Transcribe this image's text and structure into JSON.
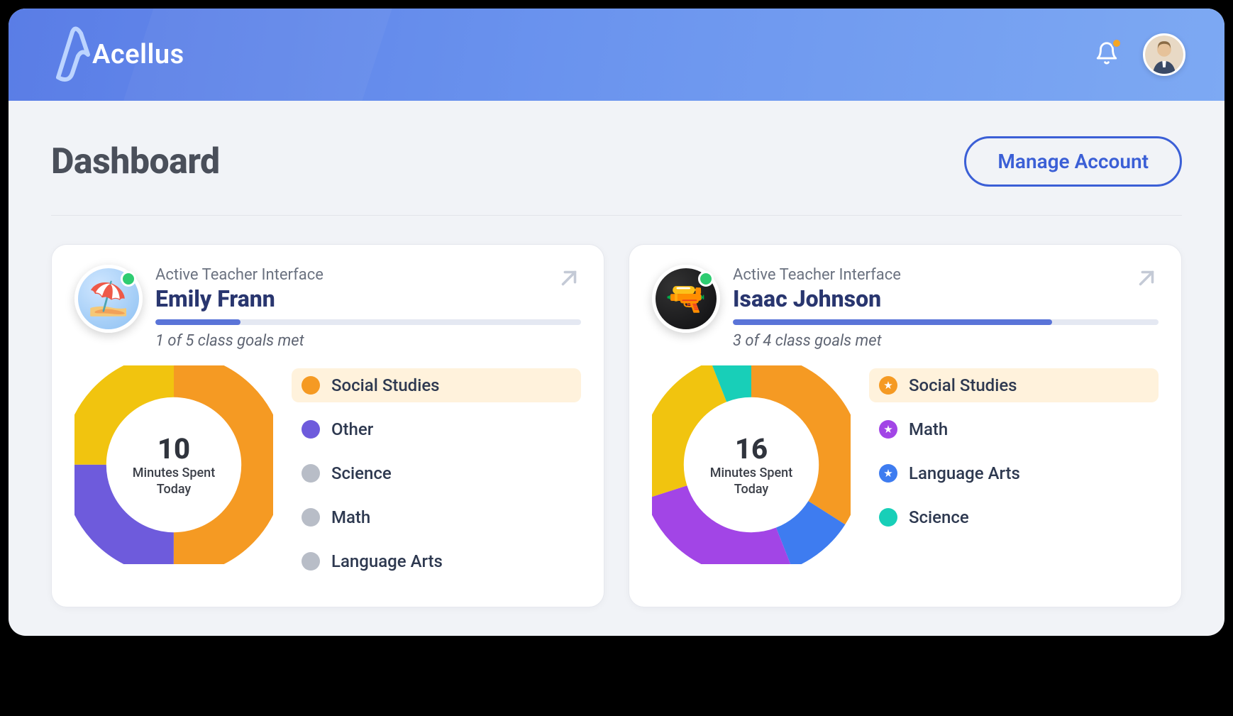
{
  "brand": "Acellus",
  "header": {
    "manage_button": "Manage Account"
  },
  "page_title": "Dashboard",
  "donut_labels": {
    "line1": "Minutes Spent",
    "line2": "Today"
  },
  "chart_data": [
    {
      "type": "pie",
      "title": "Emily Frann — Minutes Spent Today",
      "total_minutes": 10,
      "series": [
        {
          "name": "Social Studies",
          "value": 50,
          "color": "#f59a23"
        },
        {
          "name": "Other",
          "value": 25,
          "color": "#6e5bdc"
        },
        {
          "name": "Science",
          "value": 0,
          "color": "#b8bdc7"
        },
        {
          "name": "Math",
          "value": 0,
          "color": "#b8bdc7"
        },
        {
          "name": "Language Arts",
          "value": 0,
          "color": "#b8bdc7"
        }
      ],
      "extra_slice": {
        "name": "Unlabeled",
        "value": 25,
        "color": "#f1c40f"
      }
    },
    {
      "type": "pie",
      "title": "Isaac Johnson — Minutes Spent Today",
      "total_minutes": 16,
      "series": [
        {
          "name": "Social Studies",
          "value": 34,
          "color": "#f59a23",
          "starred": true
        },
        {
          "name": "Math",
          "value": 26,
          "color": "#a245e6",
          "starred": true
        },
        {
          "name": "Language Arts",
          "value": 10,
          "color": "#3e7cf0",
          "starred": true
        },
        {
          "name": "Science",
          "value": 6,
          "color": "#18cfb8",
          "starred": false
        }
      ],
      "extra_slice": {
        "name": "Unlabeled",
        "value": 24,
        "color": "#f1c40f"
      }
    }
  ],
  "students": [
    {
      "interface_label": "Active Teacher Interface",
      "name": "Emily Frann",
      "avatar_bg": "blue",
      "avatar_emoji": "⛱️",
      "goals_met": 1,
      "goals_total": 5,
      "goals_text": "1 of 5 class goals met",
      "progress_pct": 20,
      "minutes": "10",
      "legend": [
        {
          "label": "Social Studies",
          "color": "#f59a23",
          "highlight": true
        },
        {
          "label": "Other",
          "color": "#6e5bdc"
        },
        {
          "label": "Science",
          "color": "#b8bdc7"
        },
        {
          "label": "Math",
          "color": "#b8bdc7"
        },
        {
          "label": "Language Arts",
          "color": "#b8bdc7"
        }
      ],
      "donut": [
        {
          "pct": 50,
          "color": "#f59a23"
        },
        {
          "pct": 25,
          "color": "#6e5bdc"
        },
        {
          "pct": 25,
          "color": "#f1c40f"
        }
      ]
    },
    {
      "interface_label": "Active Teacher Interface",
      "name": "Isaac Johnson",
      "avatar_bg": "dark",
      "avatar_emoji": "🔫",
      "goals_met": 3,
      "goals_total": 4,
      "goals_text": "3 of 4 class goals met",
      "progress_pct": 75,
      "minutes": "16",
      "legend": [
        {
          "label": "Social Studies",
          "color": "#f59a23",
          "highlight": true,
          "star": true
        },
        {
          "label": "Math",
          "color": "#a245e6",
          "star": true
        },
        {
          "label": "Language Arts",
          "color": "#3e7cf0",
          "star": true
        },
        {
          "label": "Science",
          "color": "#18cfb8"
        }
      ],
      "donut": [
        {
          "pct": 34,
          "color": "#f59a23"
        },
        {
          "pct": 10,
          "color": "#3e7cf0"
        },
        {
          "pct": 26,
          "color": "#a245e6"
        },
        {
          "pct": 24,
          "color": "#f1c40f"
        },
        {
          "pct": 6,
          "color": "#18cfb8"
        }
      ]
    }
  ]
}
